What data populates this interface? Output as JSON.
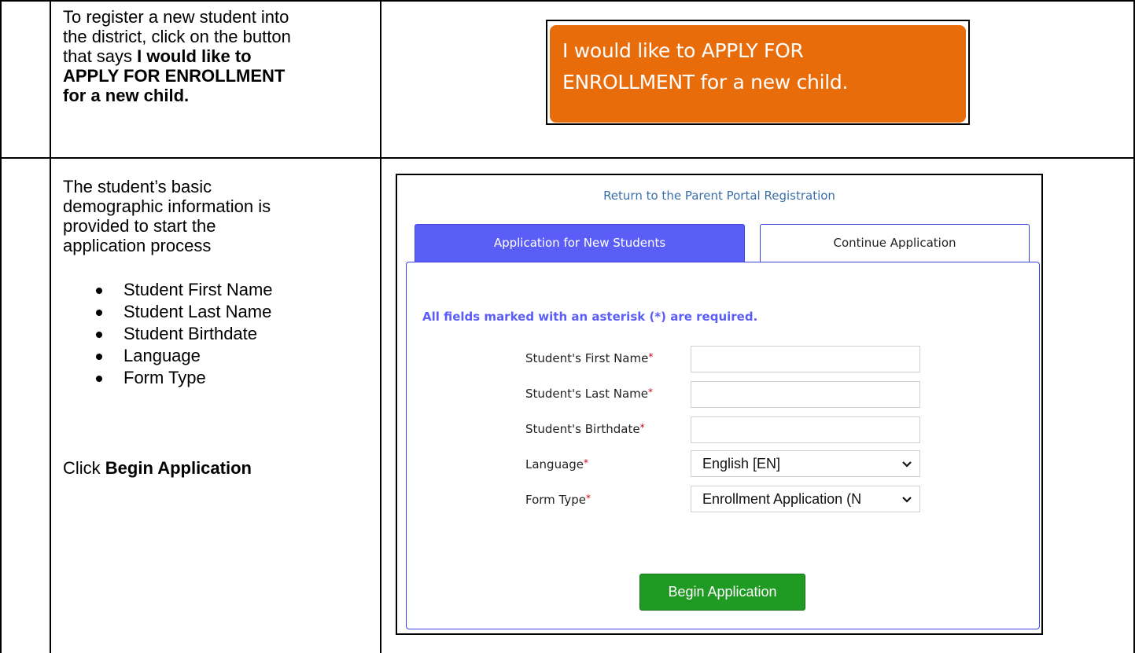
{
  "row1": {
    "instruction_lines": [
      "To register a new student into",
      "the district, click on the button",
      "that says "
    ],
    "instruction_bold_lines": [
      "I would like to",
      "APPLY FOR ENROLLMENT",
      "for a new child."
    ],
    "apply_button": {
      "line1": "I would like to APPLY FOR",
      "line2": "ENROLLMENT for a new child."
    }
  },
  "row2": {
    "intro_lines": [
      "The student’s basic",
      "demographic information is",
      "provided to start the",
      "application process"
    ],
    "bullets": [
      "Student First Name",
      "Student Last Name",
      "Student Birthdate",
      "Language",
      "Form Type"
    ],
    "click_prefix": "Click ",
    "click_bold": "Begin Application"
  },
  "form": {
    "portal_link": "Return to the Parent Portal Registration",
    "tabs": [
      "Application for New Students",
      "Continue Application"
    ],
    "required_note": "All fields marked with an asterisk (*) are required.",
    "fields": [
      {
        "label": "Student's First Name",
        "value": ""
      },
      {
        "label": "Student's Last Name",
        "value": ""
      },
      {
        "label": "Student's Birthdate",
        "value": ""
      }
    ],
    "selects": [
      {
        "label": "Language",
        "value": "English [EN]"
      },
      {
        "label": "Form Type",
        "value": "Enrollment Application (N"
      }
    ],
    "asterisk": "*",
    "begin_button": "Begin Application"
  },
  "colors": {
    "apply_orange": "#e96c0b",
    "tab_active": "#5b5ef6",
    "begin_green": "#1f9a23",
    "link_blue": "#3b6ea8",
    "required_red": "#d0021b"
  }
}
